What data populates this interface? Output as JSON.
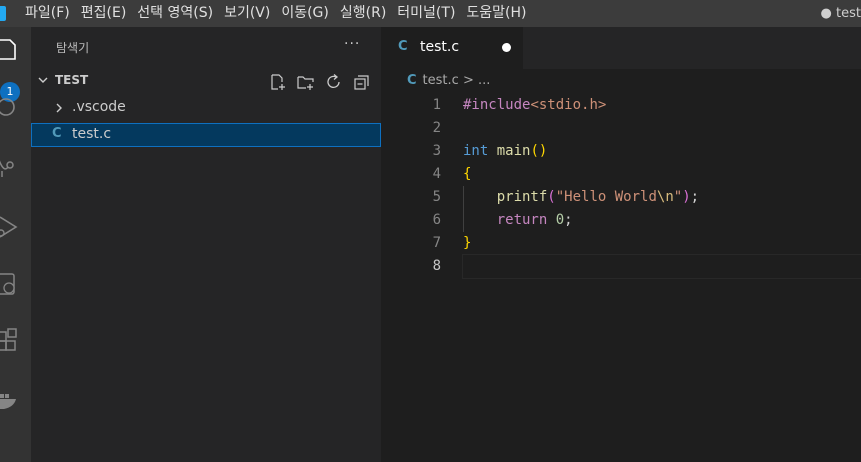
{
  "menu": [
    "파일(F)",
    "편집(E)",
    "선택 영역(S)",
    "보기(V)",
    "이동(G)",
    "실행(R)",
    "터미널(T)",
    "도움말(H)"
  ],
  "window_title": "● test",
  "activity": {
    "explorer_badge": "1"
  },
  "sidebar": {
    "title": "탐색기",
    "more": "···",
    "section_label": "TEST",
    "folder": ".vscode",
    "file": "test.c",
    "file_icon_letter": "C"
  },
  "tab": {
    "icon_letter": "C",
    "label": "test.c"
  },
  "breadcrumb": {
    "icon_letter": "C",
    "file": "test.c",
    "rest": "> ..."
  },
  "line_numbers": [
    "1",
    "2",
    "3",
    "4",
    "5",
    "6",
    "7",
    "8"
  ],
  "code": {
    "l1_pre": "#include",
    "l1_inc": "<stdio.h>",
    "l3_kw": "int",
    "l3_fn": "main",
    "l3_paren": "()",
    "l4_brace": "{",
    "l5_indent": "    ",
    "l5_fn": "printf",
    "l5_open": "(",
    "l5_str1": "\"Hello World",
    "l5_esc": "\\n",
    "l5_str2": "\"",
    "l5_close": ")",
    "l5_semi": ";",
    "l6_indent": "    ",
    "l6_kw": "return",
    "l6_sp": " ",
    "l6_num": "0",
    "l6_semi": ";",
    "l7_brace": "}"
  },
  "colors": {
    "accent": "#0e70c0",
    "c_icon": "#519aba",
    "selection": "#04395e"
  }
}
